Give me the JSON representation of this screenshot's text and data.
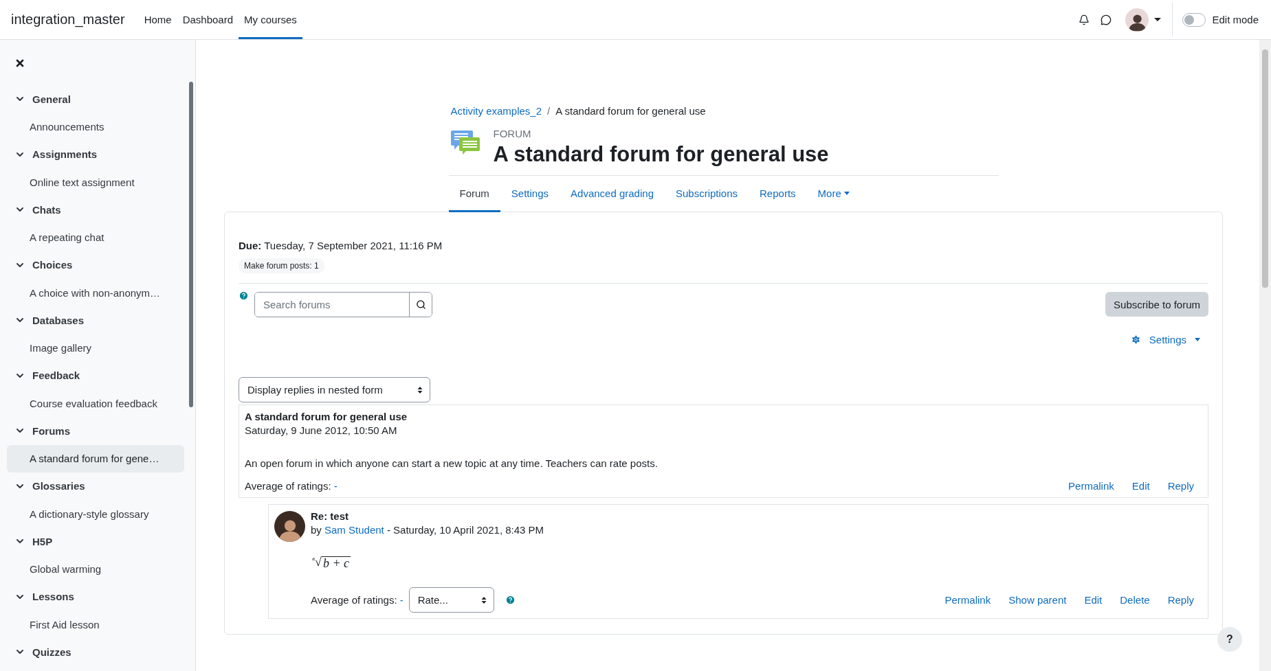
{
  "navbar": {
    "brand": "integration_master",
    "links": [
      {
        "label": "Home",
        "selected": false
      },
      {
        "label": "Dashboard",
        "selected": false
      },
      {
        "label": "My courses",
        "selected": true
      }
    ],
    "edit_mode": {
      "label": "Edit mode",
      "on": false
    }
  },
  "sidebar": {
    "sections": [
      {
        "title": "General",
        "expanded": true,
        "items": [
          {
            "label": "Announcements",
            "selected": false
          }
        ]
      },
      {
        "title": "Assignments",
        "expanded": true,
        "items": [
          {
            "label": "Online text assignment",
            "selected": false
          }
        ]
      },
      {
        "title": "Chats",
        "expanded": true,
        "items": [
          {
            "label": "A repeating chat",
            "selected": false
          }
        ]
      },
      {
        "title": "Choices",
        "expanded": true,
        "items": [
          {
            "label": "A choice with non-anonym…",
            "selected": false
          }
        ]
      },
      {
        "title": "Databases",
        "expanded": true,
        "items": [
          {
            "label": "Image gallery",
            "selected": false
          }
        ]
      },
      {
        "title": "Feedback",
        "expanded": true,
        "items": [
          {
            "label": "Course evaluation feedback",
            "selected": false
          }
        ]
      },
      {
        "title": "Forums",
        "expanded": true,
        "items": [
          {
            "label": "A standard forum for gene…",
            "selected": true
          }
        ]
      },
      {
        "title": "Glossaries",
        "expanded": true,
        "items": [
          {
            "label": "A dictionary-style glossary",
            "selected": false
          }
        ]
      },
      {
        "title": "H5P",
        "expanded": true,
        "items": [
          {
            "label": "Global warming",
            "selected": false
          }
        ]
      },
      {
        "title": "Lessons",
        "expanded": true,
        "items": [
          {
            "label": "First Aid lesson",
            "selected": false
          }
        ]
      },
      {
        "title": "Quizzes",
        "expanded": true
      }
    ]
  },
  "breadcrumb": [
    {
      "label": "Activity examples_2",
      "kind": "link"
    },
    {
      "label": "/",
      "kind": "separator"
    },
    {
      "label": "A standard forum for general use",
      "kind": "current"
    }
  ],
  "activity": {
    "type_label": "FORUM",
    "title": "A standard forum for general use"
  },
  "tabs": [
    {
      "label": "Forum",
      "selected": true,
      "kind": "tab"
    },
    {
      "label": "Settings",
      "selected": false,
      "kind": "tab"
    },
    {
      "label": "Advanced grading",
      "selected": false,
      "kind": "tab"
    },
    {
      "label": "Subscriptions",
      "selected": false,
      "kind": "tab"
    },
    {
      "label": "Reports",
      "selected": false,
      "kind": "tab"
    },
    {
      "label": "More",
      "selected": false,
      "kind": "menu"
    }
  ],
  "due": {
    "label": "Due:",
    "value": "Tuesday, 7 September 2021, 11:16 PM"
  },
  "completion": "Make forum posts: 1",
  "search": {
    "placeholder": "Search forums"
  },
  "subscribe_button": "Subscribe to forum",
  "settings_menu": "Settings",
  "display_mode": "Display replies in nested form",
  "posts": [
    {
      "kind": "discussion",
      "subject": "A standard forum for general use",
      "date": "Saturday, 9 June 2012, 10:50 AM",
      "body": "An open forum in which anyone can start a new topic at any time. Teachers can rate posts.",
      "rating_label": "Average of ratings:",
      "rating_value": "-",
      "actions": [
        "Permalink",
        "Edit",
        "Reply"
      ]
    },
    {
      "kind": "reply",
      "subject": "Re: test",
      "by": "by",
      "author": "Sam Student",
      "date": " - Saturday, 10 April 2021, 8:43 PM",
      "math": {
        "index": "a",
        "radical": "√",
        "radicand": "b + c"
      },
      "rating_label": "Average of ratings:",
      "rating_value": "-",
      "rate_select": "Rate...",
      "actions": [
        "Permalink",
        "Show parent",
        "Edit",
        "Delete",
        "Reply"
      ]
    }
  ],
  "help_button": "?"
}
